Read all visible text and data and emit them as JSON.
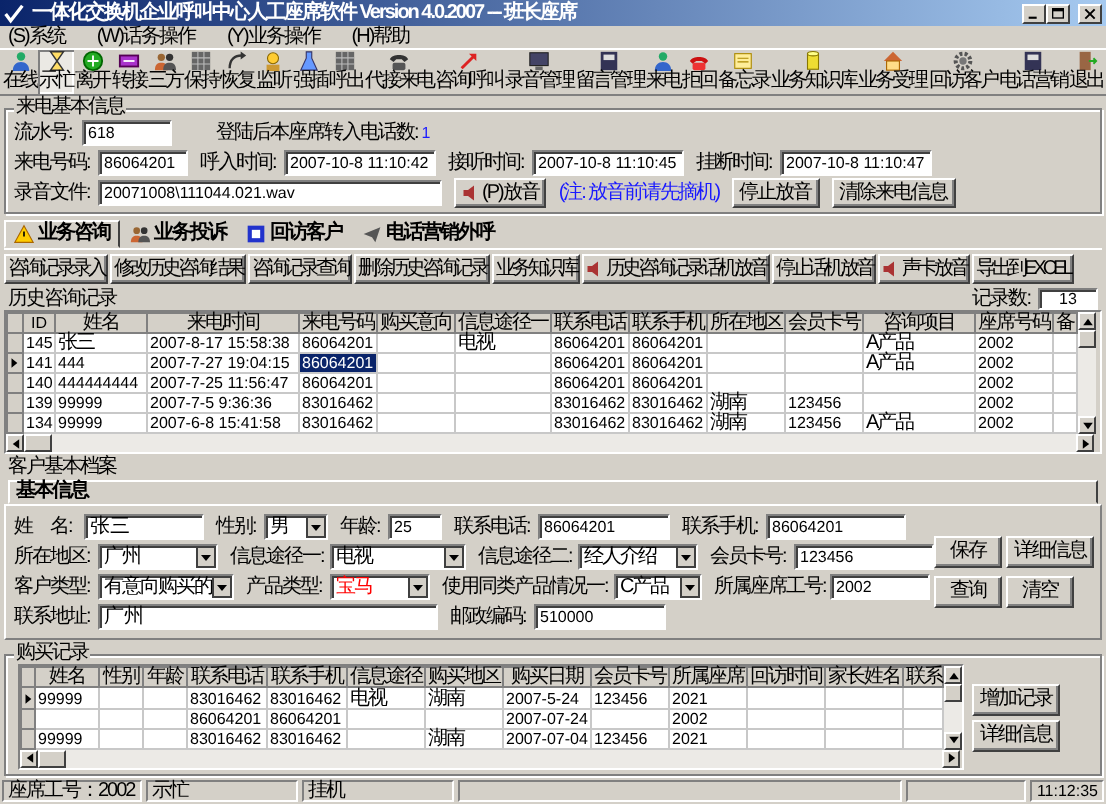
{
  "window": {
    "title": "一体化交换机企业呼叫中心人工座席软件 Version 4.0.2007 --- 班长座席"
  },
  "menu": [
    "(S)系统",
    "(W)话务操作",
    "(Y)业务操作",
    "(H)帮助"
  ],
  "toolbar": [
    {
      "label": "在线",
      "selected": false
    },
    {
      "label": "示忙",
      "selected": true
    },
    {
      "label": "离开",
      "selected": false
    },
    {
      "label": "转接",
      "selected": false
    },
    {
      "label": "三方",
      "selected": false
    },
    {
      "label": "保持",
      "selected": false
    },
    {
      "label": "恢复",
      "selected": false
    },
    {
      "label": "监听",
      "selected": false
    },
    {
      "label": "强插",
      "selected": false
    },
    {
      "label": "呼出",
      "selected": false
    },
    {
      "label": "代接来电",
      "selected": false
    },
    {
      "label": "咨询呼叫",
      "selected": false
    },
    {
      "label": "录音管理",
      "selected": false
    },
    {
      "label": "留言管理",
      "selected": false
    },
    {
      "label": "来电",
      "selected": false
    },
    {
      "label": "拒回",
      "selected": false
    },
    {
      "label": "备忘录",
      "selected": false
    },
    {
      "label": "业务知识库",
      "selected": false
    },
    {
      "label": "业务受理",
      "selected": false
    },
    {
      "label": "回访客户",
      "selected": false
    },
    {
      "label": "电话营销",
      "selected": false
    },
    {
      "label": "退出",
      "selected": false
    }
  ],
  "call_info": {
    "title": "来电基本信息",
    "fields": [
      {
        "kind": "field",
        "label": "流水号:",
        "value": "618"
      },
      {
        "kind": "count",
        "label": "登陆后本座席转入电话数:",
        "value": "1"
      },
      {
        "kind": "field",
        "label": "来电号码:",
        "value": "86064201"
      },
      {
        "kind": "field",
        "label": "呼入时间:",
        "value": "2007-10-8 11:10:42"
      },
      {
        "kind": "field",
        "label": "接听时间:",
        "value": "2007-10-8 11:10:45"
      },
      {
        "kind": "field",
        "label": "挂断时间:",
        "value": "2007-10-8 11:10:47"
      },
      {
        "kind": "field",
        "label": "录音文件:",
        "value": "20071008\\111044.021.wav"
      },
      {
        "kind": "audio_button",
        "label": "(P)放音"
      },
      {
        "kind": "note",
        "label": "(注: 放音前请先摘机)"
      },
      {
        "kind": "button",
        "label": "停止放音"
      },
      {
        "kind": "button",
        "label": "清除来电信息"
      }
    ]
  },
  "tabs": [
    {
      "label": "业务咨询",
      "selected": true
    },
    {
      "label": "业务投诉",
      "selected": false
    },
    {
      "label": "回访客户",
      "selected": false
    },
    {
      "label": "电话营销外呼",
      "selected": false
    }
  ],
  "actions": [
    {
      "kind": "button",
      "label": "咨询记录录入"
    },
    {
      "kind": "button",
      "label": "修改历史咨询结果"
    },
    {
      "kind": "button",
      "label": "咨询记录查询"
    },
    {
      "kind": "button",
      "label": "删除历史咨询记录"
    },
    {
      "kind": "button",
      "label": "业务知识库"
    },
    {
      "kind": "audio_button",
      "label": "历史咨询记录话机放音"
    },
    {
      "kind": "button",
      "label": "停止话机放音"
    },
    {
      "kind": "audio_button",
      "label": "声卡放音"
    },
    {
      "kind": "button",
      "label": "导出到EXCEL"
    }
  ],
  "history": {
    "title": "历史咨询记录",
    "record_count_label": "记录数:",
    "record_count": "13",
    "columns": [
      "ID",
      "姓名",
      "来电时间",
      "来电号码",
      "购买意向",
      "信息途径一",
      "联系电话",
      "联系手机",
      "所在地区",
      "会员卡号",
      "咨询项目",
      "座席号码",
      "备"
    ],
    "rows": [
      {
        "selected": false,
        "cells": [
          "145",
          "张三",
          "2007-8-17 15:58:38",
          "86064201",
          "",
          "电视",
          "86064201",
          "86064201",
          "",
          "",
          "A产品",
          "2002",
          ""
        ]
      },
      {
        "selected": true,
        "cells": [
          "141",
          "444",
          "2007-7-27 19:04:15",
          {
            "text": "86064201",
            "selected": true
          },
          "",
          "",
          "86064201",
          "86064201",
          "",
          "",
          "A产品",
          "2002",
          ""
        ]
      },
      {
        "selected": false,
        "cells": [
          "140",
          "444444444",
          "2007-7-25 11:56:47",
          "86064201",
          "",
          "",
          "86064201",
          "86064201",
          "",
          "",
          "",
          "2002",
          ""
        ]
      },
      {
        "selected": false,
        "cells": [
          "139",
          "99999",
          "2007-7-5 9:36:36",
          "83016462",
          "",
          "",
          "83016462",
          "83016462",
          "湖南",
          "123456",
          "",
          "2002",
          ""
        ]
      },
      {
        "selected": false,
        "cells": [
          "134",
          "99999",
          "2007-6-8 15:41:58",
          "83016462",
          "",
          "",
          "83016462",
          "83016462",
          "湖南",
          "123456",
          "A产品",
          "2002",
          ""
        ]
      }
    ]
  },
  "customer": {
    "title": "客户基本档案",
    "tabs": [
      {
        "label": "基本信息",
        "selected": true
      }
    ],
    "fields": [
      {
        "kind": "input",
        "label": "姓　名:",
        "value": "张三"
      },
      {
        "kind": "select",
        "label": "性别:",
        "value": "男"
      },
      {
        "kind": "input",
        "label": "年龄:",
        "value": "25"
      },
      {
        "kind": "input",
        "label": "联系电话:",
        "value": "86064201"
      },
      {
        "kind": "input",
        "label": "联系手机:",
        "value": "86064201"
      },
      {
        "kind": "select",
        "label": "所在地区:",
        "value": "广州"
      },
      {
        "kind": "select",
        "label": "信息途径一:",
        "value": "电视"
      },
      {
        "kind": "select",
        "label": "信息途径二:",
        "value": "经人介绍"
      },
      {
        "kind": "input",
        "label": "会员卡号:",
        "value": "123456"
      },
      {
        "kind": "select",
        "label": "客户类型:",
        "value": "有意向购买的"
      },
      {
        "kind": "select",
        "label": "产品类型:",
        "value": "宝马",
        "color": "#ff0000"
      },
      {
        "kind": "select",
        "label": "使用同类产品情况一:",
        "value": "C产品"
      },
      {
        "kind": "input",
        "label": "所属座席工号:",
        "value": "2002"
      },
      {
        "kind": "input",
        "label": "联系地址:",
        "value": "广州"
      },
      {
        "kind": "input",
        "label": "邮政编码:",
        "value": "510000"
      }
    ],
    "buttons": [
      "保存",
      "详细信息",
      "查询",
      "清空"
    ]
  },
  "purchases": {
    "title": "购买记录",
    "columns": [
      "姓名",
      "性别",
      "年龄",
      "联系电话",
      "联系手机",
      "信息途径",
      "购买地区",
      "购买日期",
      "会员卡号",
      "所属座席",
      "回访时间",
      "家长姓名",
      "联系"
    ],
    "rows": [
      {
        "selected": true,
        "cells": [
          "99999",
          "",
          "",
          "83016462",
          "83016462",
          "电视",
          "湖南",
          "2007-5-24",
          "123456",
          "2021",
          "",
          "",
          ""
        ]
      },
      {
        "selected": false,
        "cells": [
          "",
          "",
          "",
          "86064201",
          "86064201",
          "",
          "",
          "2007-07-24",
          "",
          "2002",
          "",
          "",
          ""
        ]
      },
      {
        "selected": false,
        "cells": [
          "99999",
          "",
          "",
          "83016462",
          "83016462",
          "",
          "湖南",
          "2007-07-04",
          "123456",
          "2021",
          "",
          "",
          ""
        ]
      }
    ],
    "buttons": [
      "增加记录",
      "详细信息"
    ]
  },
  "status_bar": [
    "座席工号：2002",
    "示忙",
    "挂机",
    "11:12:35"
  ]
}
